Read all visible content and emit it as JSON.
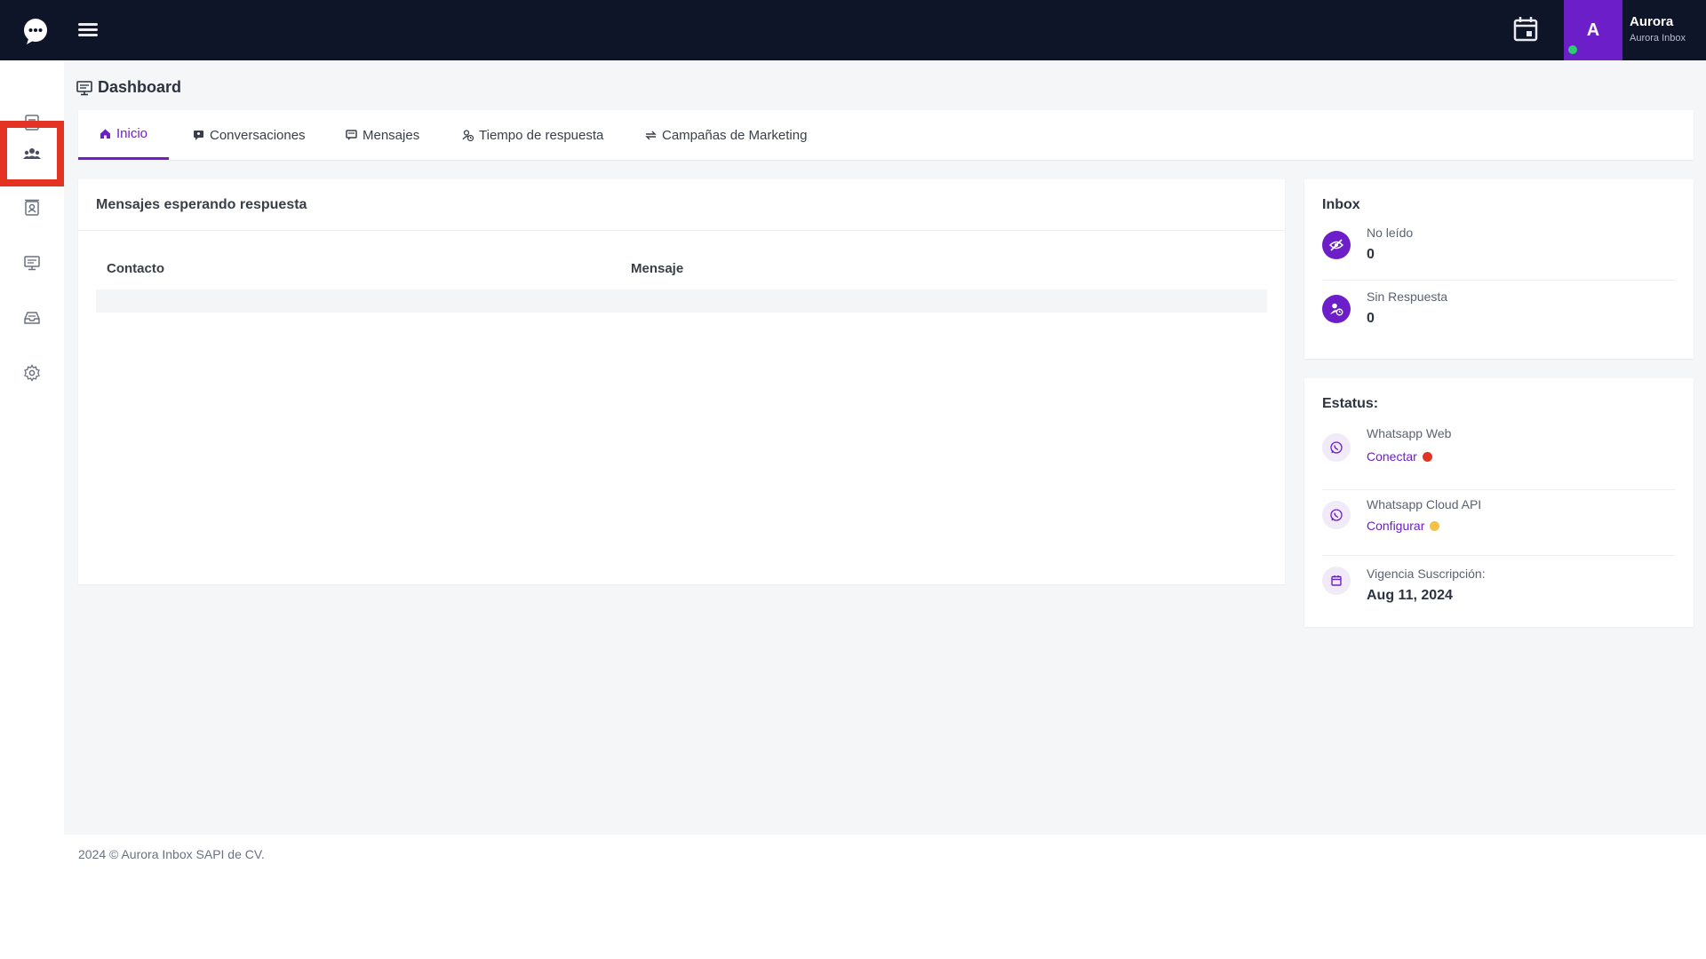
{
  "app": {
    "user_initial": "A",
    "user_name": "Aurora",
    "user_subtitle": "Aurora Inbox"
  },
  "sidebar": {
    "items": [
      {
        "icon": "document-icon"
      },
      {
        "icon": "users-icon",
        "active": true
      },
      {
        "icon": "contacts-icon"
      },
      {
        "icon": "monitor-icon"
      },
      {
        "icon": "inbox-tray-icon"
      },
      {
        "icon": "gear-icon"
      }
    ]
  },
  "page": {
    "title": "Dashboard"
  },
  "tabs": [
    {
      "label": "Inicio",
      "active": true
    },
    {
      "label": "Conversaciones"
    },
    {
      "label": "Mensajes"
    },
    {
      "label": "Tiempo de respuesta"
    },
    {
      "label": "Campañas de Marketing"
    }
  ],
  "messages_card": {
    "title": "Mensajes esperando respuesta",
    "columns": [
      "Contacto",
      "Mensaje"
    ]
  },
  "inbox": {
    "title": "Inbox",
    "unread_label": "No leído",
    "unread_value": "0",
    "unanswered_label": "Sin Respuesta",
    "unanswered_value": "0"
  },
  "status": {
    "title": "Estatus:",
    "web_label": "Whatsapp Web",
    "web_action": "Conectar",
    "web_color": "#e53323",
    "cloud_label": "Whatsapp Cloud API",
    "cloud_action": "Configurar",
    "cloud_color": "#f5c242",
    "subscription_label": "Vigencia Suscripción:",
    "subscription_value": "Aug 11, 2024"
  },
  "footer": {
    "text": "2024 © Aurora Inbox SAPI de CV."
  },
  "colors": {
    "accent": "#6c1fc9",
    "topbar": "#0f1528",
    "highlight": "#e53323"
  }
}
